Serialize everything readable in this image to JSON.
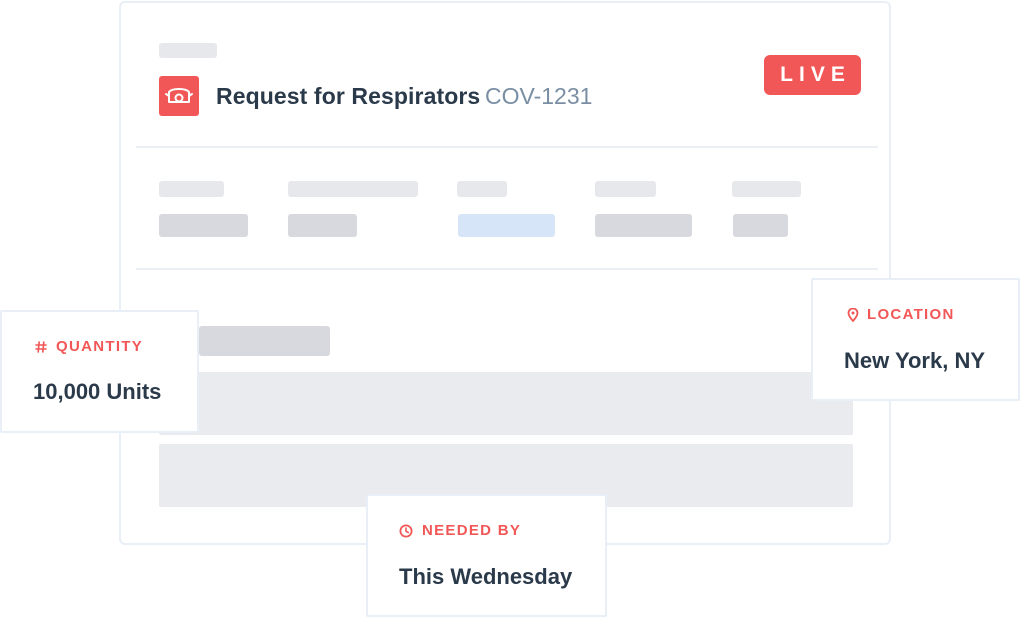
{
  "request": {
    "title": "Request for Respirators",
    "code": "COV-1231",
    "status": "LIVE",
    "icon": "respirator-mask-icon"
  },
  "quantity": {
    "label": "QUANTITY",
    "value": "10,000 Units",
    "icon": "hash-icon"
  },
  "location": {
    "label": "LOCATION",
    "value": "New York, NY",
    "icon": "map-pin-icon"
  },
  "needed_by": {
    "label": "NEEDED BY",
    "value": "This Wednesday",
    "icon": "clock-icon"
  },
  "colors": {
    "accent": "#f25757",
    "text": "#2b3a4a",
    "muted": "#7a8ea3",
    "border": "#e8eff7",
    "skeleton": "#e6e8ec",
    "skeleton_highlight": "#d6e5f7"
  }
}
